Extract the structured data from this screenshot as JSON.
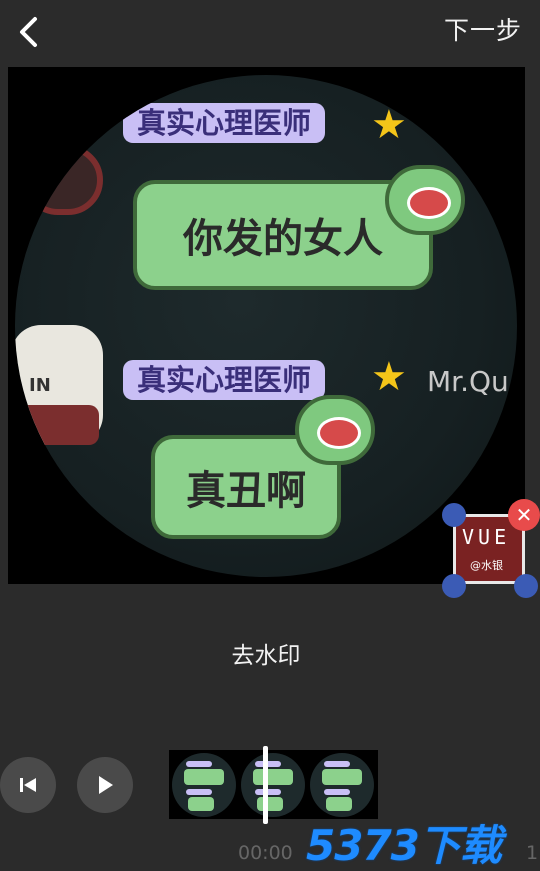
{
  "header": {
    "next_label": "下一步"
  },
  "preview": {
    "tag_1": "真实心理医师",
    "bubble_1": "你发的女人",
    "tag_2": "真实心理医师",
    "bubble_2": "真丑啊",
    "side_text": "Mr.Qu",
    "dog_text": "IN"
  },
  "watermark": {
    "text": "VUE",
    "sub": "@水银"
  },
  "actions": {
    "remove_watermark": "去水印"
  },
  "timeline": {
    "time_start": "00:00",
    "time_end": "1"
  },
  "brand_logo": "5373下载",
  "colors": {
    "background": "#2b2b2b",
    "bubble_green": "#8cd18c",
    "tag_purple": "#c9bff5",
    "close_red": "#e84b4b",
    "handle_blue": "#3b5bb5",
    "brand_blue": "#1e8bff"
  },
  "icons": {
    "back": "chevron-left-icon",
    "skip_start": "skip-to-start-icon",
    "play": "play-icon",
    "close": "close-icon"
  }
}
